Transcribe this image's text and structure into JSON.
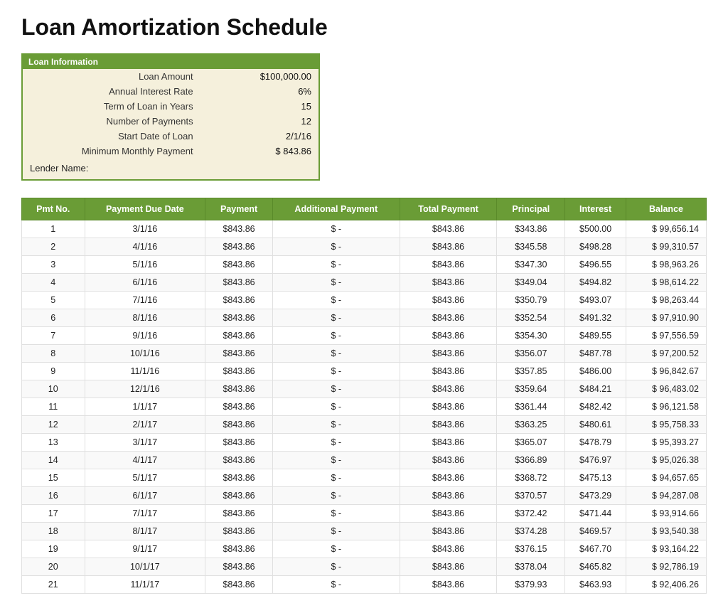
{
  "title": "Loan Amortization Schedule",
  "infoBox": {
    "header": "Loan Information",
    "rows": [
      {
        "label": "Loan Amount",
        "value": "$100,000.00"
      },
      {
        "label": "Annual Interest Rate",
        "value": "6%"
      },
      {
        "label": "Term of Loan in Years",
        "value": "15"
      },
      {
        "label": "Number of Payments",
        "value": "12"
      },
      {
        "label": "Start Date of Loan",
        "value": "2/1/16"
      },
      {
        "label": "Minimum Monthly Payment",
        "value": "$    843.86"
      }
    ],
    "lender": "Lender Name:"
  },
  "tableHeaders": [
    "Pmt No.",
    "Payment Due Date",
    "Payment",
    "Additional Payment",
    "Total Payment",
    "Principal",
    "Interest",
    "Balance"
  ],
  "rows": [
    {
      "pmt": 1,
      "date": "3/1/16",
      "payment": "$843.86",
      "addl": "$    -",
      "total": "$843.86",
      "principal": "$343.86",
      "interest": "$500.00",
      "balance": "$    99,656.14"
    },
    {
      "pmt": 2,
      "date": "4/1/16",
      "payment": "$843.86",
      "addl": "$    -",
      "total": "$843.86",
      "principal": "$345.58",
      "interest": "$498.28",
      "balance": "$    99,310.57"
    },
    {
      "pmt": 3,
      "date": "5/1/16",
      "payment": "$843.86",
      "addl": "$    -",
      "total": "$843.86",
      "principal": "$347.30",
      "interest": "$496.55",
      "balance": "$    98,963.26"
    },
    {
      "pmt": 4,
      "date": "6/1/16",
      "payment": "$843.86",
      "addl": "$    -",
      "total": "$843.86",
      "principal": "$349.04",
      "interest": "$494.82",
      "balance": "$    98,614.22"
    },
    {
      "pmt": 5,
      "date": "7/1/16",
      "payment": "$843.86",
      "addl": "$    -",
      "total": "$843.86",
      "principal": "$350.79",
      "interest": "$493.07",
      "balance": "$    98,263.44"
    },
    {
      "pmt": 6,
      "date": "8/1/16",
      "payment": "$843.86",
      "addl": "$    -",
      "total": "$843.86",
      "principal": "$352.54",
      "interest": "$491.32",
      "balance": "$    97,910.90"
    },
    {
      "pmt": 7,
      "date": "9/1/16",
      "payment": "$843.86",
      "addl": "$    -",
      "total": "$843.86",
      "principal": "$354.30",
      "interest": "$489.55",
      "balance": "$    97,556.59"
    },
    {
      "pmt": 8,
      "date": "10/1/16",
      "payment": "$843.86",
      "addl": "$    -",
      "total": "$843.86",
      "principal": "$356.07",
      "interest": "$487.78",
      "balance": "$    97,200.52"
    },
    {
      "pmt": 9,
      "date": "11/1/16",
      "payment": "$843.86",
      "addl": "$    -",
      "total": "$843.86",
      "principal": "$357.85",
      "interest": "$486.00",
      "balance": "$    96,842.67"
    },
    {
      "pmt": 10,
      "date": "12/1/16",
      "payment": "$843.86",
      "addl": "$    -",
      "total": "$843.86",
      "principal": "$359.64",
      "interest": "$484.21",
      "balance": "$    96,483.02"
    },
    {
      "pmt": 11,
      "date": "1/1/17",
      "payment": "$843.86",
      "addl": "$    -",
      "total": "$843.86",
      "principal": "$361.44",
      "interest": "$482.42",
      "balance": "$    96,121.58"
    },
    {
      "pmt": 12,
      "date": "2/1/17",
      "payment": "$843.86",
      "addl": "$    -",
      "total": "$843.86",
      "principal": "$363.25",
      "interest": "$480.61",
      "balance": "$    95,758.33"
    },
    {
      "pmt": 13,
      "date": "3/1/17",
      "payment": "$843.86",
      "addl": "$    -",
      "total": "$843.86",
      "principal": "$365.07",
      "interest": "$478.79",
      "balance": "$    95,393.27"
    },
    {
      "pmt": 14,
      "date": "4/1/17",
      "payment": "$843.86",
      "addl": "$    -",
      "total": "$843.86",
      "principal": "$366.89",
      "interest": "$476.97",
      "balance": "$    95,026.38"
    },
    {
      "pmt": 15,
      "date": "5/1/17",
      "payment": "$843.86",
      "addl": "$    -",
      "total": "$843.86",
      "principal": "$368.72",
      "interest": "$475.13",
      "balance": "$    94,657.65"
    },
    {
      "pmt": 16,
      "date": "6/1/17",
      "payment": "$843.86",
      "addl": "$    -",
      "total": "$843.86",
      "principal": "$370.57",
      "interest": "$473.29",
      "balance": "$    94,287.08"
    },
    {
      "pmt": 17,
      "date": "7/1/17",
      "payment": "$843.86",
      "addl": "$    -",
      "total": "$843.86",
      "principal": "$372.42",
      "interest": "$471.44",
      "balance": "$    93,914.66"
    },
    {
      "pmt": 18,
      "date": "8/1/17",
      "payment": "$843.86",
      "addl": "$    -",
      "total": "$843.86",
      "principal": "$374.28",
      "interest": "$469.57",
      "balance": "$    93,540.38"
    },
    {
      "pmt": 19,
      "date": "9/1/17",
      "payment": "$843.86",
      "addl": "$    -",
      "total": "$843.86",
      "principal": "$376.15",
      "interest": "$467.70",
      "balance": "$    93,164.22"
    },
    {
      "pmt": 20,
      "date": "10/1/17",
      "payment": "$843.86",
      "addl": "$    -",
      "total": "$843.86",
      "principal": "$378.04",
      "interest": "$465.82",
      "balance": "$    92,786.19"
    },
    {
      "pmt": 21,
      "date": "11/1/17",
      "payment": "$843.86",
      "addl": "$    -",
      "total": "$843.86",
      "principal": "$379.93",
      "interest": "$463.93",
      "balance": "$    92,406.26"
    }
  ]
}
